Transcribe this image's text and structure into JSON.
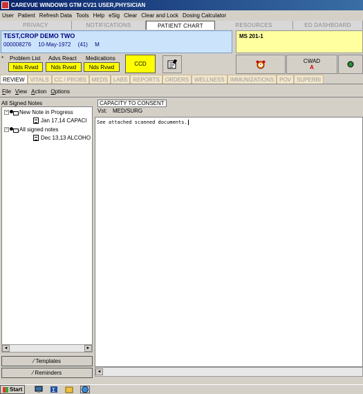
{
  "window": {
    "title": "CAREVUE WINDOWS GTM CV21 USER,PHYSICIAN"
  },
  "menu": [
    "User",
    "Patient",
    "Refresh Data",
    "Tools",
    "Help",
    "eSig",
    "Clear",
    "Clear and Lock",
    "Dosing Calculator"
  ],
  "top_tabs": [
    "PRIVACY",
    "NOTIFICATIONS",
    "PATIENT CHART",
    "RESOURCES",
    "ED DASHBOARD"
  ],
  "active_top_tab": "PATIENT CHART",
  "patient": {
    "name": "TEST,CROP DEMO TWO",
    "mrn": "000008276",
    "dob": "10-May-1972",
    "age": "(41)",
    "sex": "M"
  },
  "location": "MS  201-1",
  "indicators": {
    "star": "*",
    "problem_list_label": "Problem List",
    "adv_react_label": "Advs React",
    "medications_label": "Medications",
    "problem_list_value": "Nds Rvwd",
    "adv_react_value": "Nds Rvwd",
    "medications_value": "Nds Rvwd",
    "ccd": "CCD",
    "cwad_label": "CWAD",
    "cwad_value": "A"
  },
  "chart_tabs": [
    "REVIEW",
    "VITALS",
    "CC / PROBS",
    "MEDS",
    "LABS",
    "REPORTS",
    "ORDERS",
    "WELLNESS",
    "IMMUNIZATIONS",
    "POV",
    "SUPERBI"
  ],
  "active_chart_tab": "REVIEW",
  "submenu": [
    {
      "underline": "F",
      "rest": "ile"
    },
    {
      "underline": "V",
      "rest": "iew"
    },
    {
      "underline": "A",
      "rest": "ction"
    },
    {
      "underline": "O",
      "rest": "ptions"
    }
  ],
  "tree": {
    "header": "All Signed Notes",
    "box_minus": "−",
    "nodes": [
      {
        "label": "New Note in Progress"
      },
      {
        "label": "Jan 17,14  CAPACI"
      },
      {
        "label": "All signed notes"
      },
      {
        "label": "Dec 13,13  ALCOHO"
      }
    ]
  },
  "scroll_left": "◄",
  "scroll_right": "►",
  "buttons": {
    "templates": "⁄ Templates",
    "reminders": "⁄ Reminders"
  },
  "note": {
    "title": "CAPACITY TO CONSENT",
    "visit_label": "Vst:",
    "visit_value": "MED/SURG",
    "body": "See attached scanned documents."
  },
  "taskbar": {
    "start": "Start"
  }
}
